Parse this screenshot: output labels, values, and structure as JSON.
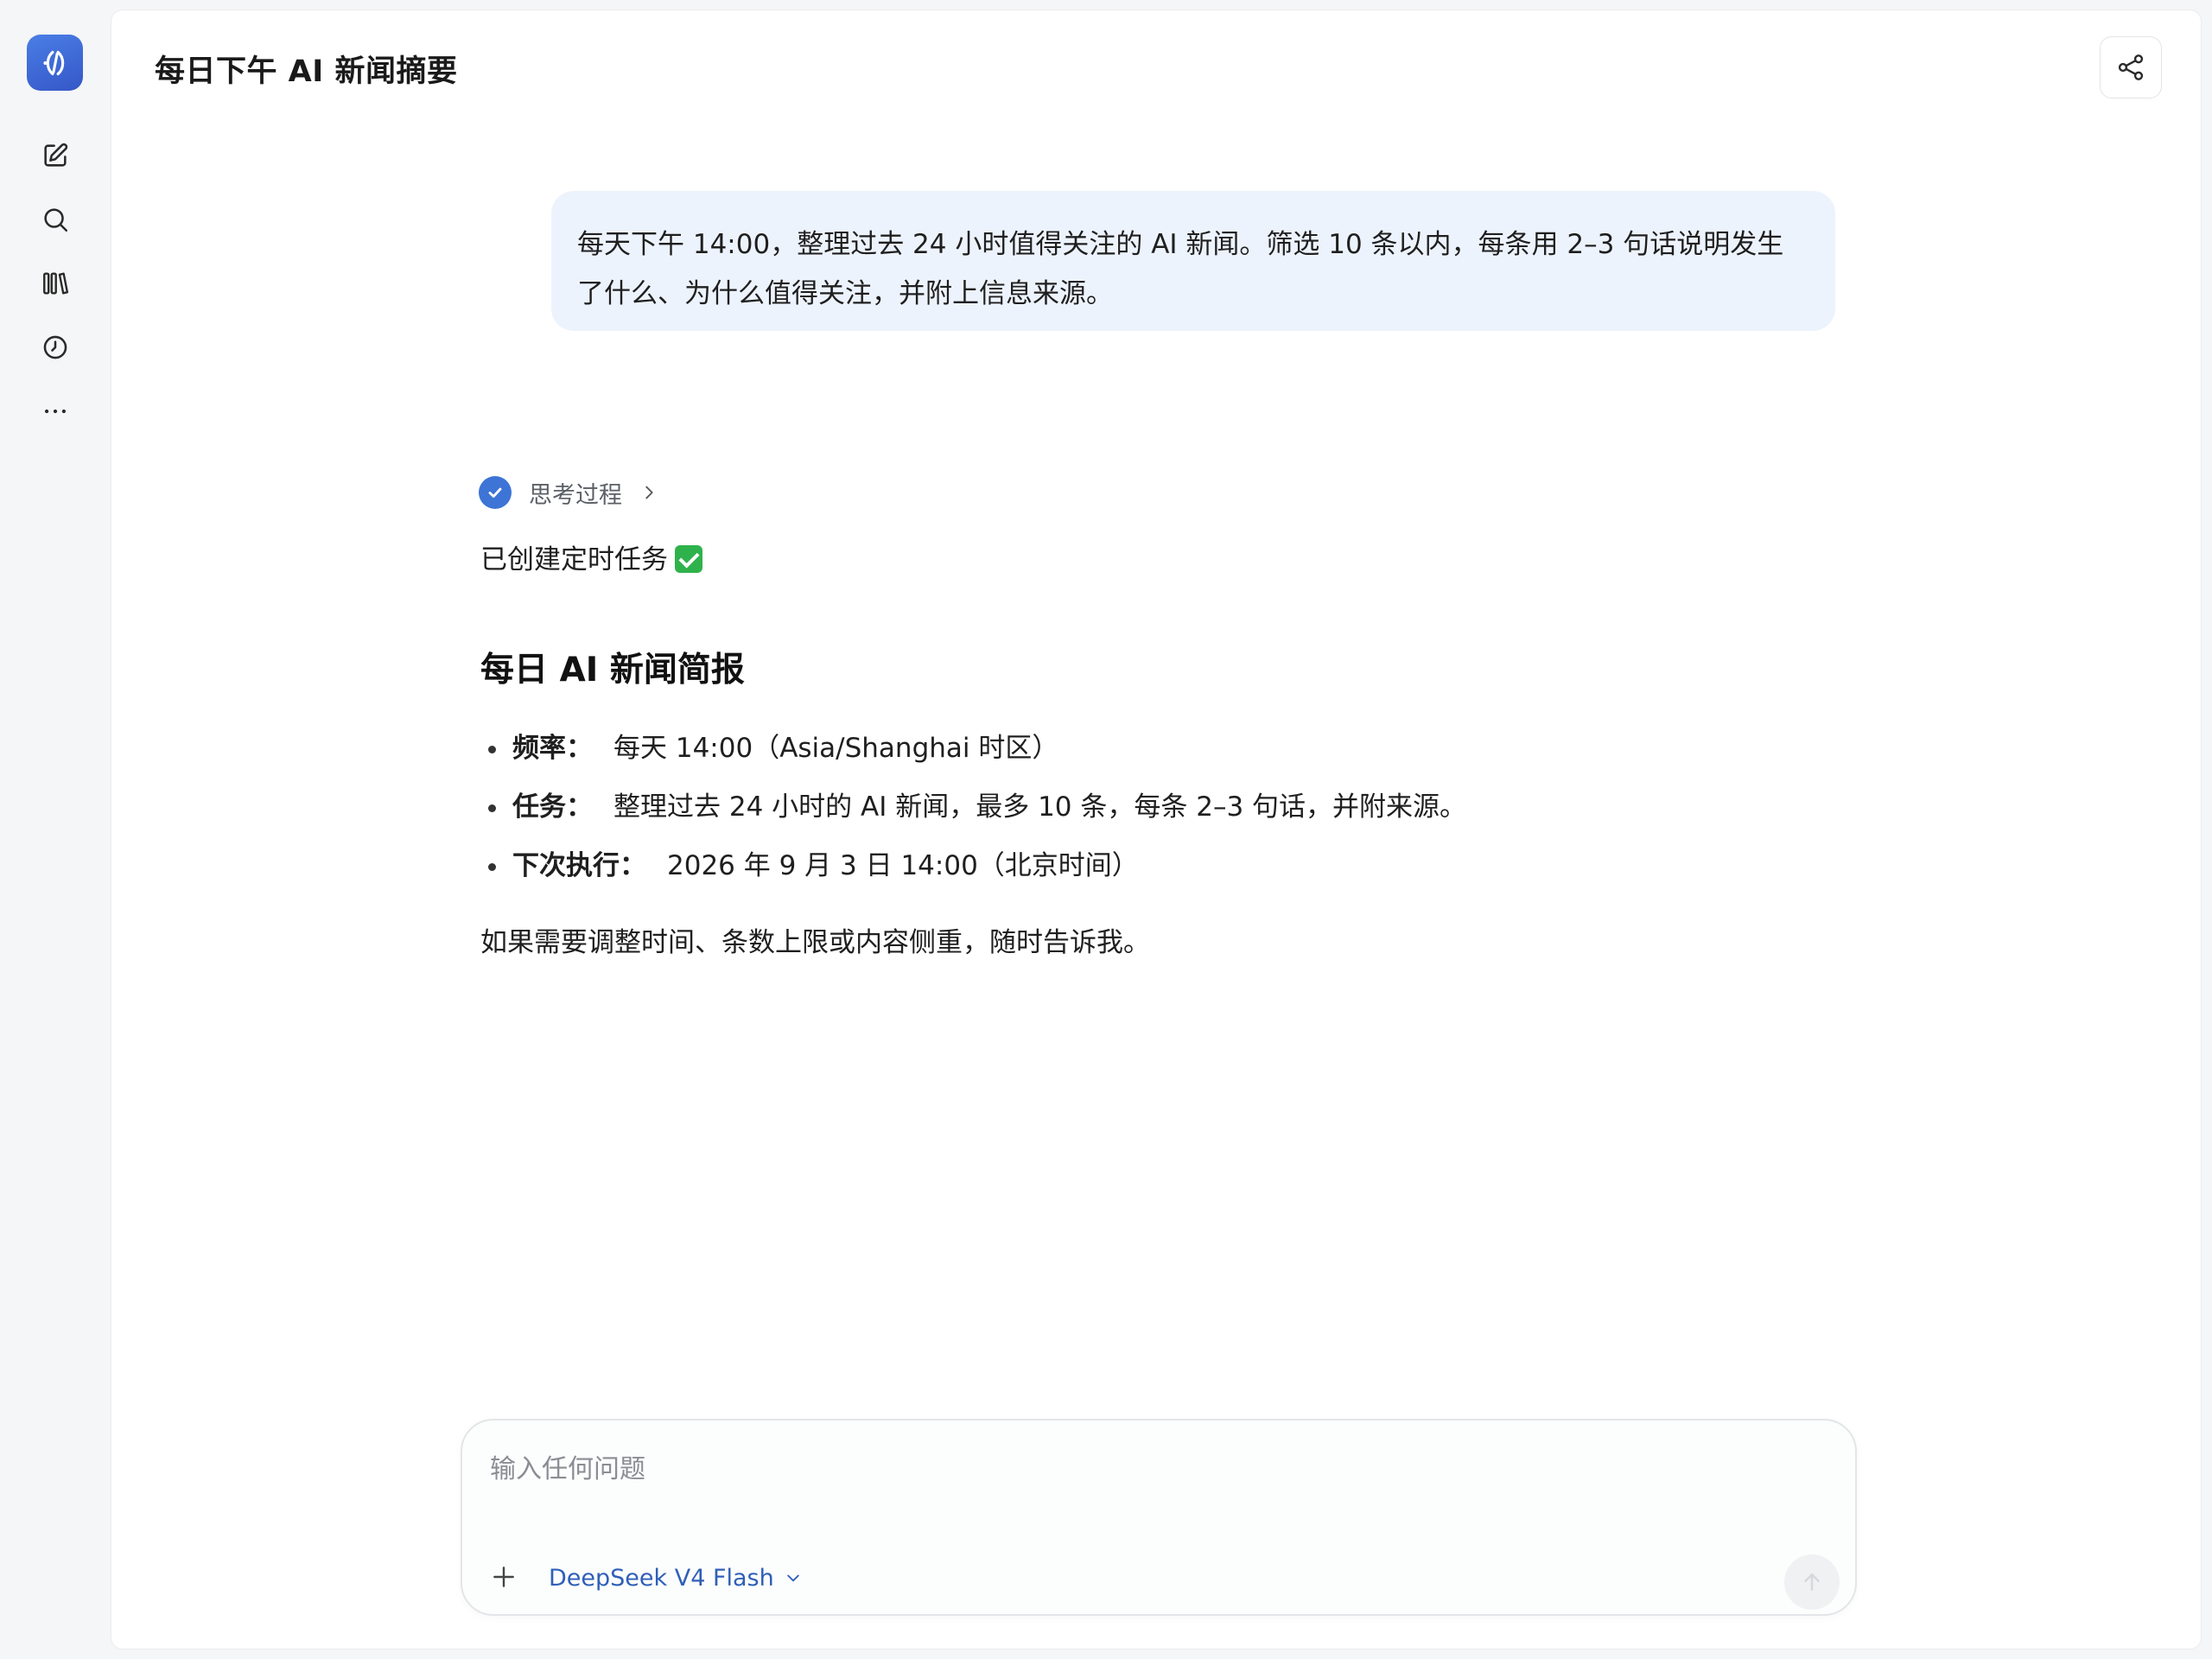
{
  "header": {
    "title": "每日下午 AI 新闻摘要"
  },
  "sidebar": {
    "items": [
      {
        "name": "new-chat",
        "icon": "edit-icon"
      },
      {
        "name": "search",
        "icon": "search-icon"
      },
      {
        "name": "library",
        "icon": "library-icon"
      },
      {
        "name": "history",
        "icon": "clock-icon"
      },
      {
        "name": "more",
        "icon": "more-icon"
      }
    ]
  },
  "conversation": {
    "user_message": "每天下午 14:00，整理过去 24 小时值得关注的 AI 新闻。筛选 10 条以内，每条用 2–3 句话说明发生了什么、为什么值得关注，并附上信息来源。",
    "thinking_label": "思考过程",
    "created_text": "已创建定时任务",
    "heading": "每日 AI 新闻简报",
    "bullets": [
      {
        "key": "频率：",
        "value": "每天 14:00（Asia/Shanghai 时区）"
      },
      {
        "key": "任务：",
        "value": "整理过去 24 小时的 AI 新闻，最多 10 条，每条 2–3 句话，并附来源。"
      },
      {
        "key": "下次执行：",
        "value": "2026 年 9 月 3 日 14:00（北京时间）"
      }
    ],
    "closing": "如果需要调整时间、条数上限或内容侧重，随时告诉我。"
  },
  "composer": {
    "placeholder": "输入任何问题",
    "model": "DeepSeek V4 Flash"
  },
  "colors": {
    "accent": "#3d74d6",
    "bubble": "#edf3fd",
    "model_text": "#2f5fb8"
  }
}
